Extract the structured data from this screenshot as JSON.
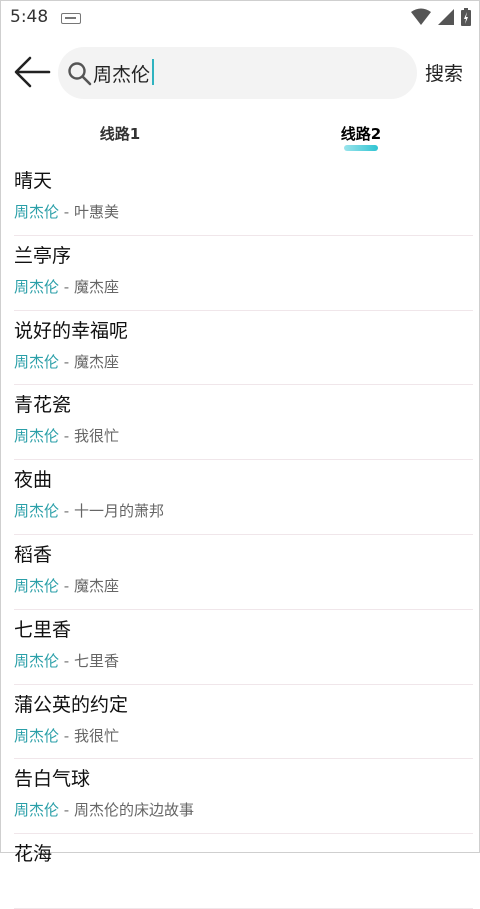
{
  "status_bar": {
    "time": "5:48"
  },
  "header": {
    "search_value": "周杰伦",
    "search_button": "搜索"
  },
  "tabs": [
    {
      "label": "线路1"
    },
    {
      "label": "线路2"
    }
  ],
  "list": {
    "separator": " - ",
    "items": [
      {
        "title": "晴天",
        "artist": "周杰伦",
        "album": "叶惠美"
      },
      {
        "title": "兰亭序",
        "artist": "周杰伦",
        "album": "魔杰座"
      },
      {
        "title": "说好的幸福呢",
        "artist": "周杰伦",
        "album": "魔杰座"
      },
      {
        "title": "青花瓷",
        "artist": "周杰伦",
        "album": "我很忙"
      },
      {
        "title": "夜曲",
        "artist": "周杰伦",
        "album": "十一月的萧邦"
      },
      {
        "title": "稻香",
        "artist": "周杰伦",
        "album": "魔杰座"
      },
      {
        "title": "七里香",
        "artist": "周杰伦",
        "album": "七里香"
      },
      {
        "title": "蒲公英的约定",
        "artist": "周杰伦",
        "album": "我很忙"
      },
      {
        "title": "告白气球",
        "artist": "周杰伦",
        "album": "周杰伦的床边故事"
      },
      {
        "title": "花海",
        "artist": "",
        "album": ""
      }
    ]
  },
  "colors": {
    "accent": "#2a9fa8",
    "tab_indicator": "#2fc4d2",
    "search_bg": "#f3f3f3"
  },
  "icons": [
    "keyboard-icon",
    "wifi-icon",
    "signal-icon",
    "battery-icon",
    "back-arrow-icon",
    "search-icon"
  ]
}
